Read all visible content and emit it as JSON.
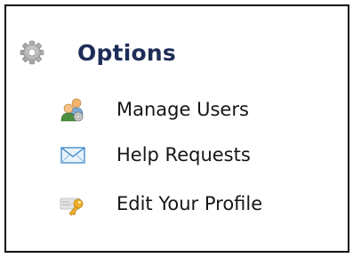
{
  "options": {
    "title": "Options",
    "title_icon": "gear-icon",
    "items": [
      {
        "label": "Manage Users",
        "icon": "users-icon"
      },
      {
        "label": "Help Requests",
        "icon": "envelope-icon"
      },
      {
        "label": "Edit Your Profile",
        "icon": "key-icon"
      }
    ]
  },
  "colors": {
    "title": "#1d2d57",
    "item_text": "#161616",
    "border": "#111111"
  }
}
